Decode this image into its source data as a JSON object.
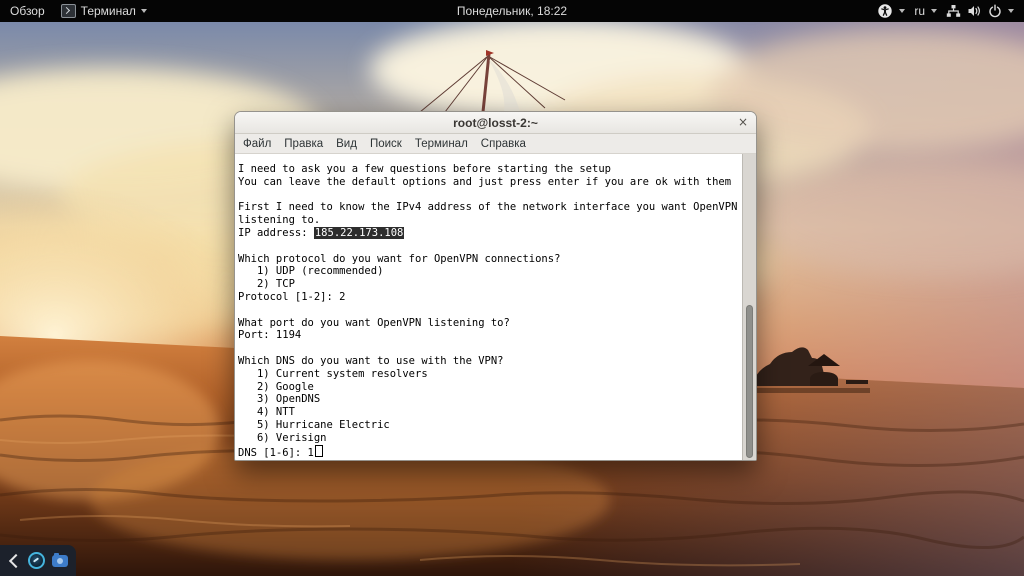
{
  "top_bar": {
    "activities_label": "Обзор",
    "app_menu_label": "Терминал",
    "clock_label": "Понедельник, 18:22",
    "keyboard_layout_label": "ru",
    "status_icons": [
      "accessibility-icon",
      "network-wired-icon",
      "volume-icon",
      "power-icon"
    ]
  },
  "window": {
    "title": "root@losst-2:~",
    "close_label": "×",
    "menu": [
      "Файл",
      "Правка",
      "Вид",
      "Поиск",
      "Терминал",
      "Справка"
    ]
  },
  "terminal": {
    "lines": [
      [
        "I need to ask you a few questions before starting the setup"
      ],
      [
        "You can leave the default options and just press enter if you are ok with them"
      ],
      [
        ""
      ],
      [
        "First I need to know the IPv4 address of the network interface you want OpenVPN"
      ],
      [
        "listening to."
      ],
      [
        "IP address: ",
        {
          "type": "selection",
          "text": "185.22.173.108"
        }
      ],
      [
        ""
      ],
      [
        "Which protocol do you want for OpenVPN connections?"
      ],
      [
        "   1) UDP (recommended)"
      ],
      [
        "   2) TCP"
      ],
      [
        "Protocol [1-2]: 2"
      ],
      [
        ""
      ],
      [
        "What port do you want OpenVPN listening to?"
      ],
      [
        "Port: 1194"
      ],
      [
        ""
      ],
      [
        "Which DNS do you want to use with the VPN?"
      ],
      [
        "   1) Current system resolvers"
      ],
      [
        "   2) Google"
      ],
      [
        "   3) OpenDNS"
      ],
      [
        "   4) NTT"
      ],
      [
        "   5) Hurricane Electric"
      ],
      [
        "   6) Verisign"
      ],
      [
        "DNS [1-6]: 1",
        {
          "type": "cursor"
        }
      ]
    ]
  },
  "colors": {
    "topbar_bg": "#050505",
    "titlebar_bg": "#f2f0ed",
    "terminal_bg": "#ffffff",
    "terminal_fg": "#000000",
    "selection_bg": "#2d2d2d",
    "selection_fg": "#ffffff",
    "dock_bg": "#1c212b",
    "dock_accent_blue": "#45b4dd"
  }
}
